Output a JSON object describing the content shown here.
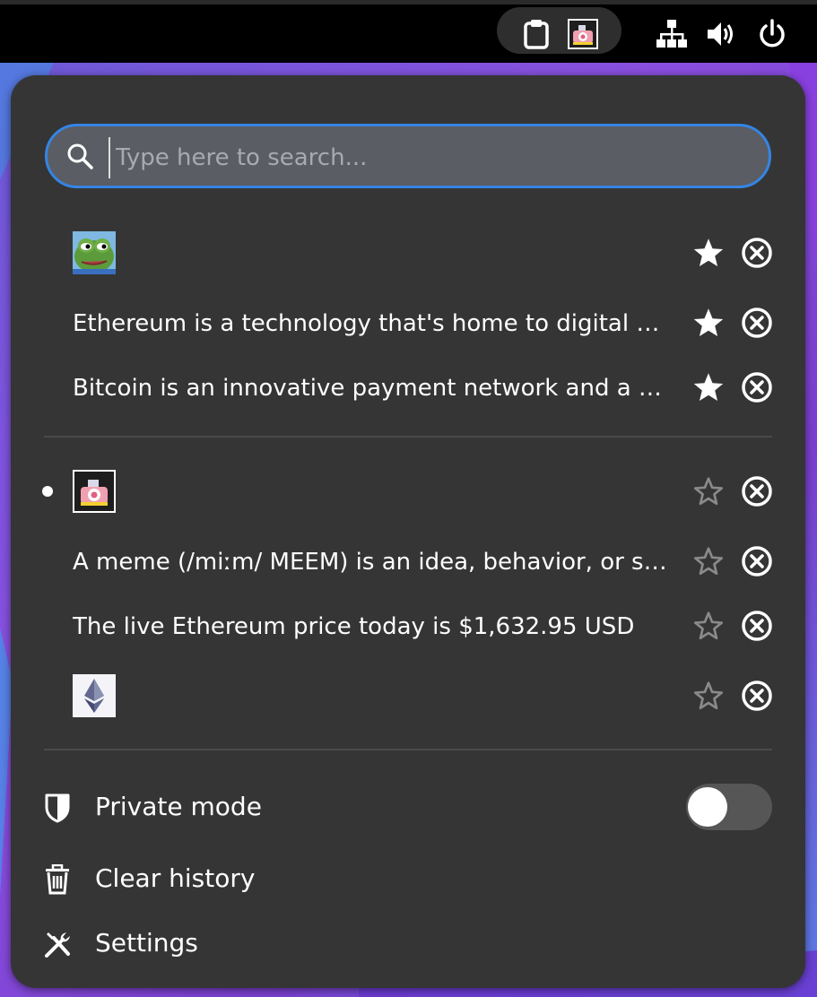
{
  "search": {
    "placeholder": "Type here to search..."
  },
  "history": {
    "favorites": [
      {
        "type": "image",
        "thumb": "pepe-frog",
        "starred": true
      },
      {
        "type": "text",
        "text": "Ethereum is a technology that's home to digital m...",
        "starred": true
      },
      {
        "type": "text",
        "text": "Bitcoin is an innovative payment network and a ne...",
        "starred": true
      }
    ],
    "recent": [
      {
        "type": "image",
        "thumb": "camera-sticker",
        "starred": false,
        "current": true
      },
      {
        "type": "text",
        "text": "A meme (/miːm/ MEEM) is an idea, behavior, or sty...",
        "starred": false
      },
      {
        "type": "text",
        "text": "The live Ethereum price today is $1,632.95 USD",
        "starred": false
      },
      {
        "type": "image",
        "thumb": "ethereum-logo",
        "starred": false
      }
    ]
  },
  "menu": {
    "private_mode": {
      "label": "Private mode",
      "enabled": false
    },
    "clear_history": {
      "label": "Clear history"
    },
    "settings": {
      "label": "Settings"
    }
  },
  "colors": {
    "accent": "#3584e4",
    "panel": "#353535",
    "topbar": "#000000"
  },
  "icons": [
    "clipboard-icon",
    "camera-sticker-icon",
    "network-icon",
    "volume-icon",
    "power-icon",
    "search-icon",
    "star-icon",
    "remove-icon",
    "shield-icon",
    "trash-icon",
    "settings-tools-icon"
  ]
}
